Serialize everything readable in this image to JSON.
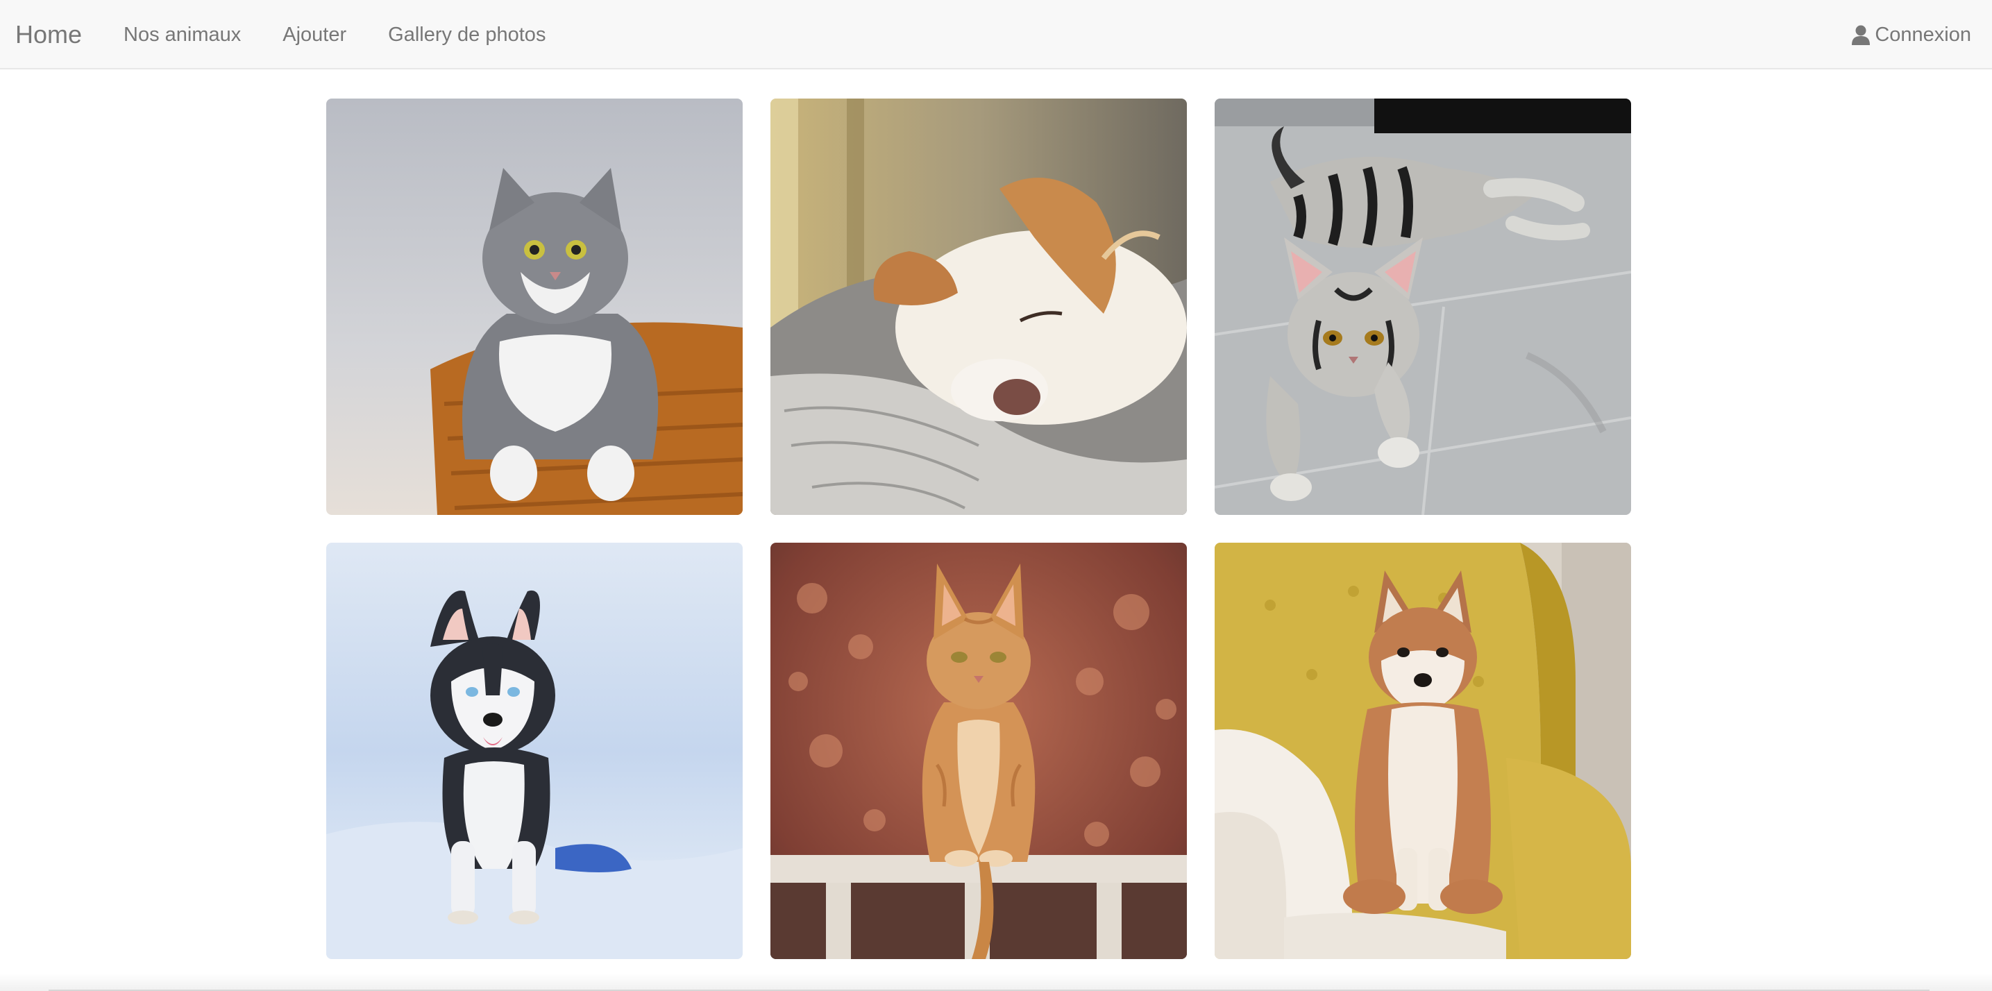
{
  "navbar": {
    "brand": "Home",
    "links": [
      "Nos animaux",
      "Ajouter",
      "Gallery de photos"
    ],
    "login_label": "Connexion",
    "login_icon": "user-icon"
  },
  "gallery": {
    "photos": [
      {
        "subject": "grey-white-cat-in-basket"
      },
      {
        "subject": "sleeping-dog-on-blanket"
      },
      {
        "subject": "silver-tabby-kitten-on-tiles"
      },
      {
        "subject": "husky-puppy-in-snow"
      },
      {
        "subject": "orange-cat-on-fence"
      },
      {
        "subject": "shiba-inu-on-yellow-armchair"
      }
    ]
  },
  "colors": {
    "navbar_bg": "#f8f8f8",
    "nav_text": "#777777"
  }
}
